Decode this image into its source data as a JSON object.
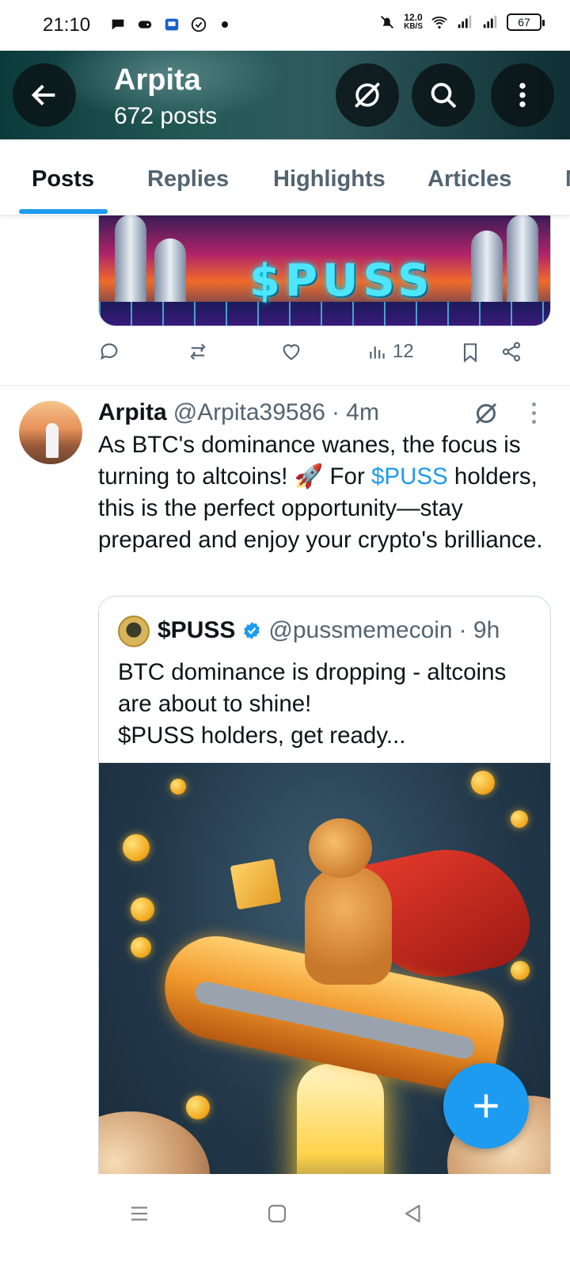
{
  "status_bar": {
    "time": "21:10",
    "net_speed_value": "12.0",
    "net_speed_unit": "KB/S",
    "battery": "67",
    "icons": [
      "chat-bubble-icon",
      "game-controller-icon",
      "app-badge-icon",
      "check-circle-icon",
      "notification-dot",
      "mute-icon",
      "wifi-icon",
      "signal-icon",
      "signal-icon",
      "battery-icon"
    ]
  },
  "header": {
    "title": "Arpita",
    "subtitle": "672 posts",
    "buttons": [
      "back-icon",
      "grok-icon",
      "search-icon",
      "more-vertical-icon"
    ]
  },
  "tabs": [
    {
      "label": "Posts",
      "active": true
    },
    {
      "label": "Replies",
      "active": false
    },
    {
      "label": "Highlights",
      "active": false
    },
    {
      "label": "Articles",
      "active": false
    },
    {
      "label": "M",
      "active": false
    }
  ],
  "previous_post": {
    "media_text": "$PUSS",
    "views": "12"
  },
  "post": {
    "author_name": "Arpita",
    "author_handle": "@Arpita39586",
    "time": "· 4m",
    "text_part1": "As BTC's dominance wanes, the focus is turning to altcoins! 🚀 For ",
    "cashtag": "$PUSS",
    "text_part2": " holders, this is the perfect opportunity—stay prepared and enjoy your crypto's brilliance.",
    "quote": {
      "name": "$PUSS",
      "verified": true,
      "handle": "@pussmemecoin",
      "time": "· 9h",
      "text_line1": "BTC dominance is dropping - altcoins are about to shine!",
      "text_line2": "$PUSS holders, get ready..."
    }
  },
  "fab": {
    "icon": "plus-icon"
  },
  "nav": [
    "menu-icon",
    "home-square-icon",
    "back-triangle-icon"
  ],
  "colors": {
    "accent": "#1d9bf0",
    "text": "#0f1419",
    "muted": "#536471"
  }
}
